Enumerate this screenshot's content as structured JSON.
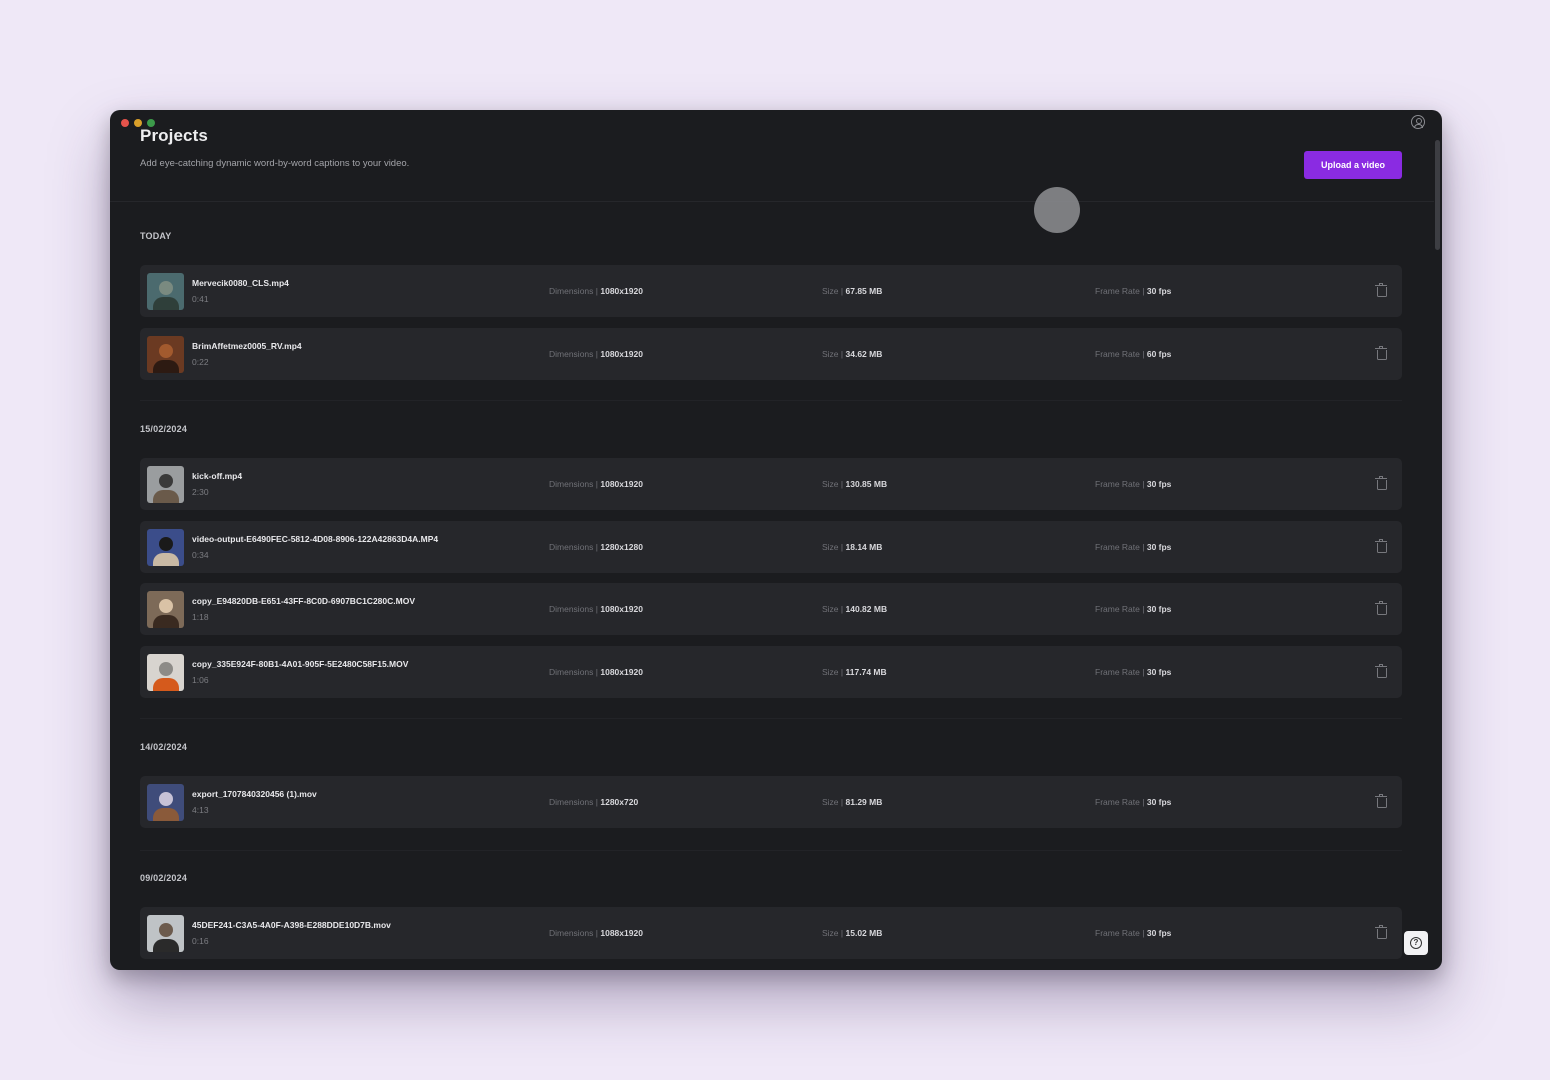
{
  "header": {
    "title": "Projects",
    "subtitle": "Add eye-catching dynamic word-by-word captions to your video.",
    "upload_label": "Upload a video"
  },
  "labels": {
    "dimensions": "Dimensions",
    "size": "Size",
    "frame_rate": "Frame Rate",
    "separator": "|"
  },
  "groups": [
    {
      "label": "TODAY",
      "items": [
        {
          "name": "Mervecik0080_CLS.mp4",
          "duration": "0:41",
          "dimensions": "1080x1920",
          "size": "67.85 MB",
          "frame_rate": "30 fps"
        },
        {
          "name": "BrimAffetmez0005_RV.mp4",
          "duration": "0:22",
          "dimensions": "1080x1920",
          "size": "34.62 MB",
          "frame_rate": "60 fps"
        }
      ]
    },
    {
      "label": "15/02/2024",
      "items": [
        {
          "name": "kick-off.mp4",
          "duration": "2:30",
          "dimensions": "1080x1920",
          "size": "130.85 MB",
          "frame_rate": "30 fps"
        },
        {
          "name": "video-output-E6490FEC-5812-4D08-8906-122A42863D4A.MP4",
          "duration": "0:34",
          "dimensions": "1280x1280",
          "size": "18.14 MB",
          "frame_rate": "30 fps"
        },
        {
          "name": "copy_E94820DB-E651-43FF-8C0D-6907BC1C280C.MOV",
          "duration": "1:18",
          "dimensions": "1080x1920",
          "size": "140.82 MB",
          "frame_rate": "30 fps"
        },
        {
          "name": "copy_335E924F-80B1-4A01-905F-5E2480C58F15.MOV",
          "duration": "1:06",
          "dimensions": "1080x1920",
          "size": "117.74 MB",
          "frame_rate": "30 fps"
        }
      ]
    },
    {
      "label": "14/02/2024",
      "items": [
        {
          "name": "export_1707840320456 (1).mov",
          "duration": "4:13",
          "dimensions": "1280x720",
          "size": "81.29 MB",
          "frame_rate": "30 fps"
        }
      ]
    },
    {
      "label": "09/02/2024",
      "items": [
        {
          "name": "45DEF241-C3A5-4A0F-A398-E288DDE10D7B.mov",
          "duration": "0:16",
          "dimensions": "1088x1920",
          "size": "15.02 MB",
          "frame_rate": "30 fps"
        }
      ]
    }
  ],
  "colors": {
    "accent": "#8a2be2",
    "window_bg": "#1b1c1f",
    "row_bg": "#26272b",
    "page_bg": "#efe8f7"
  },
  "icons": [
    "account-icon",
    "trash-icon",
    "help-icon"
  ]
}
